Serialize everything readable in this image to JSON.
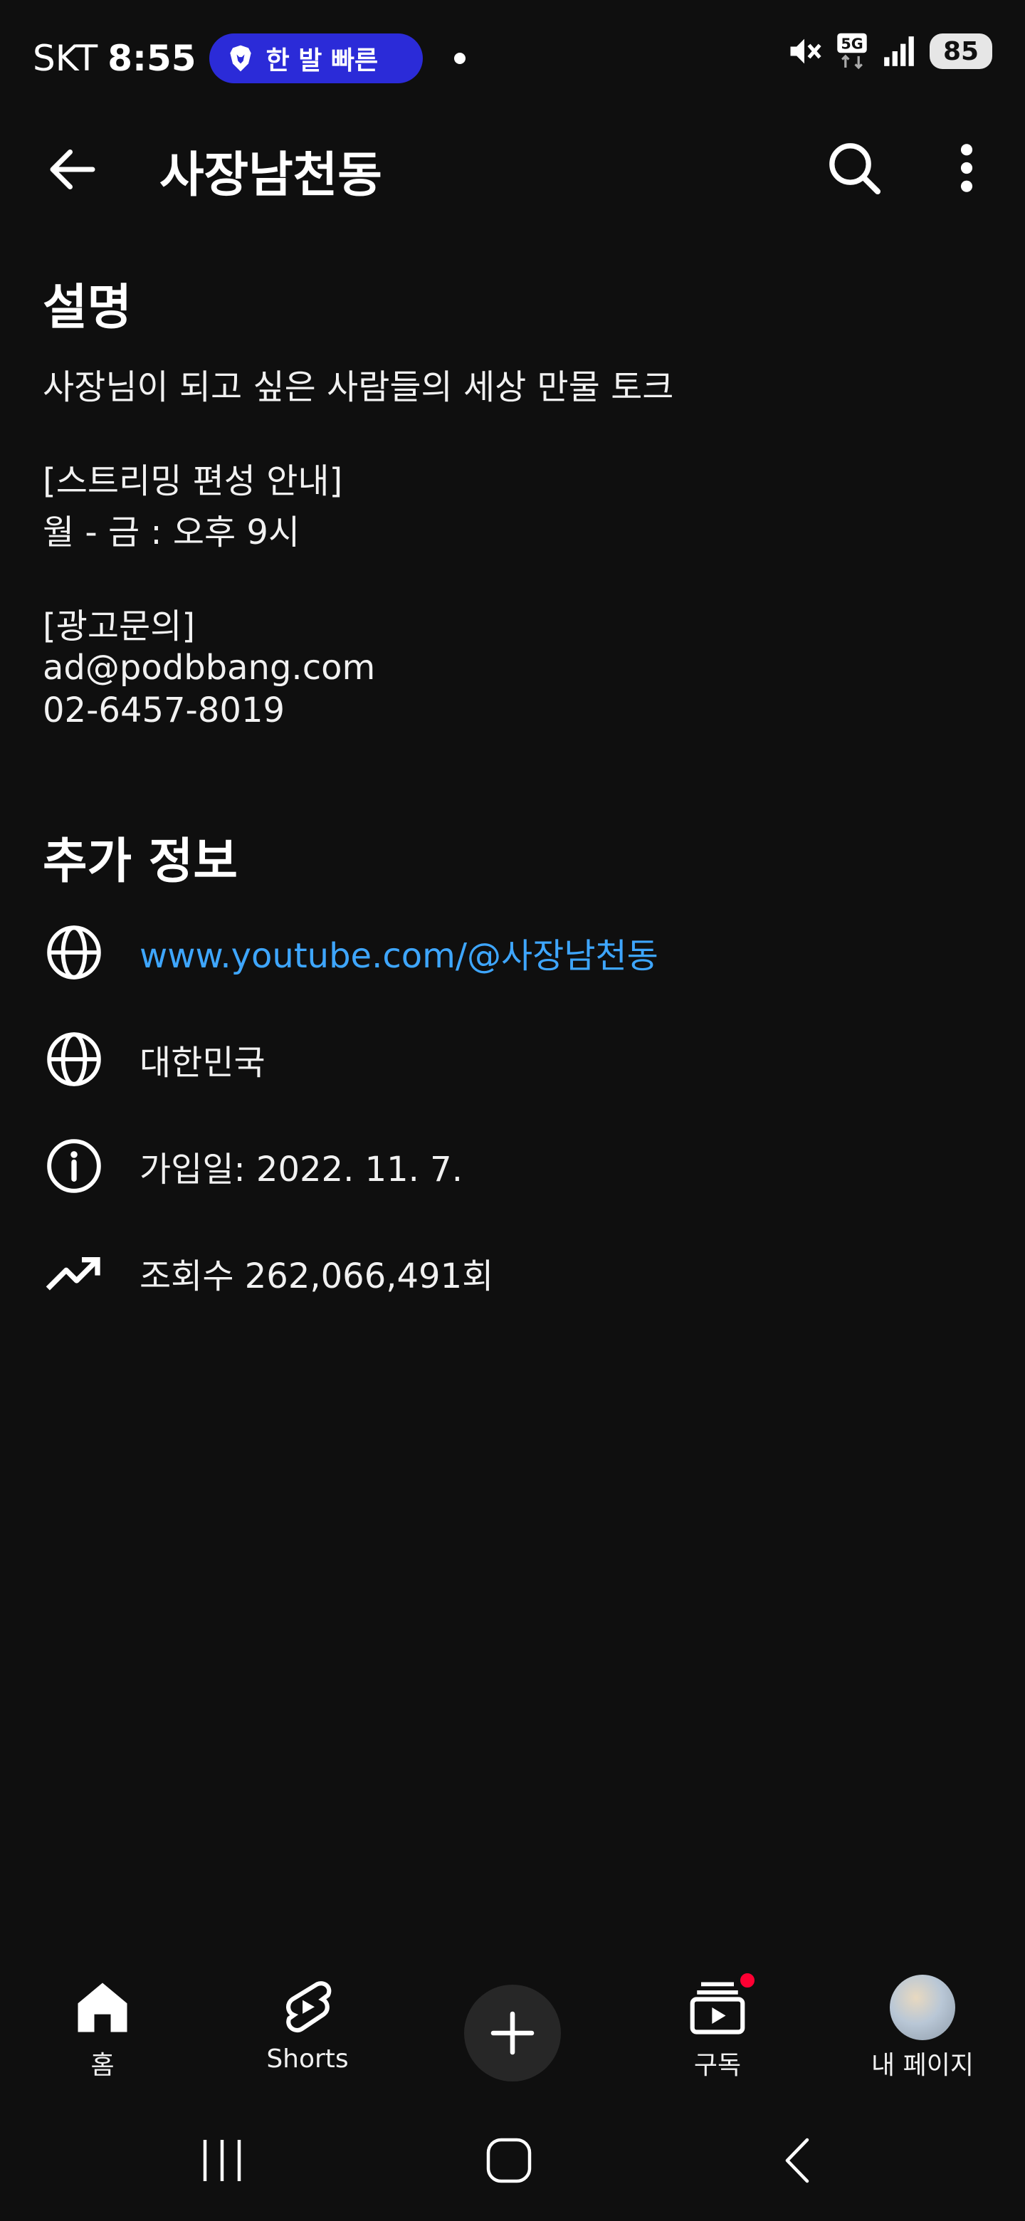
{
  "status_bar": {
    "carrier": "SKT",
    "time": "8:55",
    "notification": "한 발 빠른",
    "network": "5G",
    "battery": "85"
  },
  "app_bar": {
    "title": "사장남천동",
    "icons": [
      "back-arrow-icon",
      "search-icon",
      "more-vertical-icon"
    ]
  },
  "description": {
    "heading": "설명",
    "lines": [
      "사장님이 되고 싶은 사람들의 세상 만물 토크",
      "[스트리밍 편성 안내]",
      "월 - 금 : 오후 9시",
      "[광고문의]",
      "ad@podbbang.com",
      "02-6457-8019"
    ]
  },
  "additional_info": {
    "heading": "추가 정보",
    "items": [
      {
        "icon": "globe-icon",
        "text": "www.youtube.com/@사장남천동",
        "is_link": true
      },
      {
        "icon": "globe-icon",
        "text": "대한민국",
        "is_link": false
      },
      {
        "icon": "info-icon",
        "text": "가입일: 2022. 11. 7.",
        "is_link": false
      },
      {
        "icon": "trending-up-icon",
        "text": "조회수 262,066,491회",
        "is_link": false
      }
    ]
  },
  "bottom_nav": {
    "items": [
      {
        "label": "홈",
        "icon": "home-icon"
      },
      {
        "label": "Shorts",
        "icon": "shorts-icon"
      },
      {
        "label": "",
        "icon": "plus-icon"
      },
      {
        "label": "구독",
        "icon": "subscriptions-icon"
      },
      {
        "label": "내 페이지",
        "icon": "avatar"
      }
    ]
  },
  "colors": {
    "background": "#0f0f0f",
    "link": "#3ea6ff",
    "notification_pill": "#2b2bd8",
    "badge": "#ff0033"
  }
}
